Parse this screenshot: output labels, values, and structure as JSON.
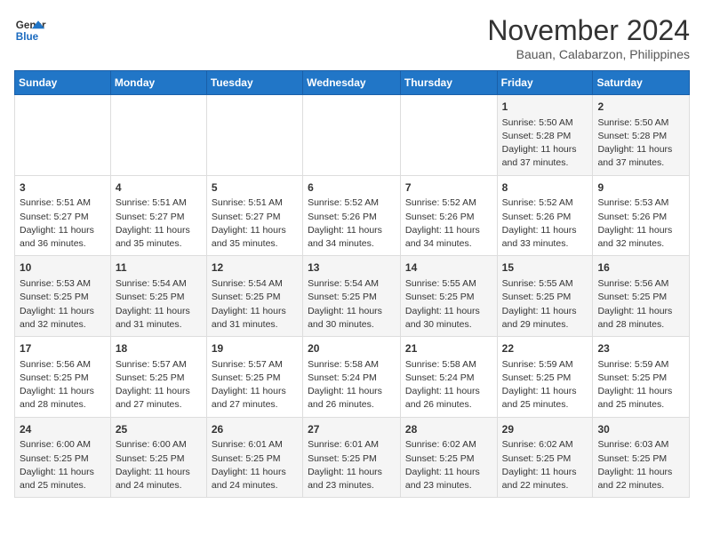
{
  "logo": {
    "line1": "General",
    "line2": "Blue"
  },
  "title": "November 2024",
  "location": "Bauan, Calabarzon, Philippines",
  "weekdays": [
    "Sunday",
    "Monday",
    "Tuesday",
    "Wednesday",
    "Thursday",
    "Friday",
    "Saturday"
  ],
  "weeks": [
    [
      {
        "day": "",
        "info": ""
      },
      {
        "day": "",
        "info": ""
      },
      {
        "day": "",
        "info": ""
      },
      {
        "day": "",
        "info": ""
      },
      {
        "day": "",
        "info": ""
      },
      {
        "day": "1",
        "info": "Sunrise: 5:50 AM\nSunset: 5:28 PM\nDaylight: 11 hours\nand 37 minutes."
      },
      {
        "day": "2",
        "info": "Sunrise: 5:50 AM\nSunset: 5:28 PM\nDaylight: 11 hours\nand 37 minutes."
      }
    ],
    [
      {
        "day": "3",
        "info": "Sunrise: 5:51 AM\nSunset: 5:27 PM\nDaylight: 11 hours\nand 36 minutes."
      },
      {
        "day": "4",
        "info": "Sunrise: 5:51 AM\nSunset: 5:27 PM\nDaylight: 11 hours\nand 35 minutes."
      },
      {
        "day": "5",
        "info": "Sunrise: 5:51 AM\nSunset: 5:27 PM\nDaylight: 11 hours\nand 35 minutes."
      },
      {
        "day": "6",
        "info": "Sunrise: 5:52 AM\nSunset: 5:26 PM\nDaylight: 11 hours\nand 34 minutes."
      },
      {
        "day": "7",
        "info": "Sunrise: 5:52 AM\nSunset: 5:26 PM\nDaylight: 11 hours\nand 34 minutes."
      },
      {
        "day": "8",
        "info": "Sunrise: 5:52 AM\nSunset: 5:26 PM\nDaylight: 11 hours\nand 33 minutes."
      },
      {
        "day": "9",
        "info": "Sunrise: 5:53 AM\nSunset: 5:26 PM\nDaylight: 11 hours\nand 32 minutes."
      }
    ],
    [
      {
        "day": "10",
        "info": "Sunrise: 5:53 AM\nSunset: 5:25 PM\nDaylight: 11 hours\nand 32 minutes."
      },
      {
        "day": "11",
        "info": "Sunrise: 5:54 AM\nSunset: 5:25 PM\nDaylight: 11 hours\nand 31 minutes."
      },
      {
        "day": "12",
        "info": "Sunrise: 5:54 AM\nSunset: 5:25 PM\nDaylight: 11 hours\nand 31 minutes."
      },
      {
        "day": "13",
        "info": "Sunrise: 5:54 AM\nSunset: 5:25 PM\nDaylight: 11 hours\nand 30 minutes."
      },
      {
        "day": "14",
        "info": "Sunrise: 5:55 AM\nSunset: 5:25 PM\nDaylight: 11 hours\nand 30 minutes."
      },
      {
        "day": "15",
        "info": "Sunrise: 5:55 AM\nSunset: 5:25 PM\nDaylight: 11 hours\nand 29 minutes."
      },
      {
        "day": "16",
        "info": "Sunrise: 5:56 AM\nSunset: 5:25 PM\nDaylight: 11 hours\nand 28 minutes."
      }
    ],
    [
      {
        "day": "17",
        "info": "Sunrise: 5:56 AM\nSunset: 5:25 PM\nDaylight: 11 hours\nand 28 minutes."
      },
      {
        "day": "18",
        "info": "Sunrise: 5:57 AM\nSunset: 5:25 PM\nDaylight: 11 hours\nand 27 minutes."
      },
      {
        "day": "19",
        "info": "Sunrise: 5:57 AM\nSunset: 5:25 PM\nDaylight: 11 hours\nand 27 minutes."
      },
      {
        "day": "20",
        "info": "Sunrise: 5:58 AM\nSunset: 5:24 PM\nDaylight: 11 hours\nand 26 minutes."
      },
      {
        "day": "21",
        "info": "Sunrise: 5:58 AM\nSunset: 5:24 PM\nDaylight: 11 hours\nand 26 minutes."
      },
      {
        "day": "22",
        "info": "Sunrise: 5:59 AM\nSunset: 5:25 PM\nDaylight: 11 hours\nand 25 minutes."
      },
      {
        "day": "23",
        "info": "Sunrise: 5:59 AM\nSunset: 5:25 PM\nDaylight: 11 hours\nand 25 minutes."
      }
    ],
    [
      {
        "day": "24",
        "info": "Sunrise: 6:00 AM\nSunset: 5:25 PM\nDaylight: 11 hours\nand 25 minutes."
      },
      {
        "day": "25",
        "info": "Sunrise: 6:00 AM\nSunset: 5:25 PM\nDaylight: 11 hours\nand 24 minutes."
      },
      {
        "day": "26",
        "info": "Sunrise: 6:01 AM\nSunset: 5:25 PM\nDaylight: 11 hours\nand 24 minutes."
      },
      {
        "day": "27",
        "info": "Sunrise: 6:01 AM\nSunset: 5:25 PM\nDaylight: 11 hours\nand 23 minutes."
      },
      {
        "day": "28",
        "info": "Sunrise: 6:02 AM\nSunset: 5:25 PM\nDaylight: 11 hours\nand 23 minutes."
      },
      {
        "day": "29",
        "info": "Sunrise: 6:02 AM\nSunset: 5:25 PM\nDaylight: 11 hours\nand 22 minutes."
      },
      {
        "day": "30",
        "info": "Sunrise: 6:03 AM\nSunset: 5:25 PM\nDaylight: 11 hours\nand 22 minutes."
      }
    ]
  ]
}
